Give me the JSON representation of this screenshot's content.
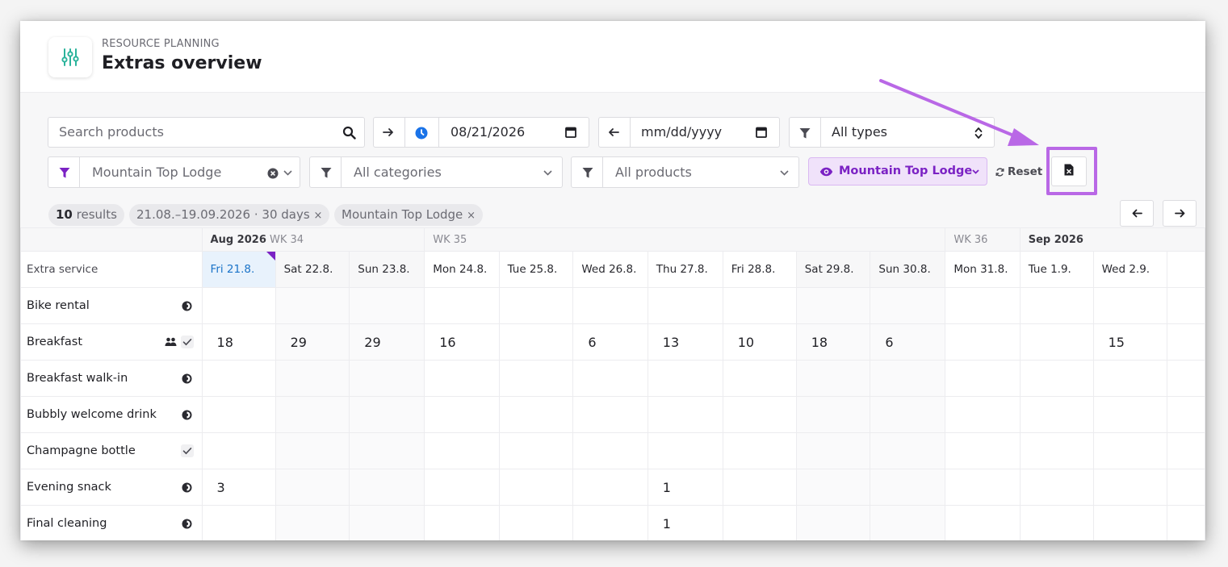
{
  "header": {
    "kicker": "RESOURCE PLANNING",
    "title": "Extras overview",
    "icon": "sliders-icon",
    "accent": "#2bb39b"
  },
  "filters": {
    "search_placeholder": "Search products",
    "from_date": "08/21/2026",
    "to_date_placeholder": "mm/dd/yyyy",
    "type_select": "All types",
    "location_select": "Mountain Top Lodge",
    "category_select": "All categories",
    "product_select": "All products",
    "view_button": "Mountain Top Lodge",
    "reset_label": "Reset"
  },
  "summary": {
    "results_count": "10",
    "results_label": "results",
    "date_chip": "21.08.–19.09.2026 · 30 days",
    "location_chip": "Mountain Top Lodge",
    "chip_remove": "×"
  },
  "calendar": {
    "week_labels": {
      "c1_month": "Aug 2026",
      "c1_week": "WK 34",
      "c4_week": "WK 35",
      "c11_week": "WK 36",
      "c12_month": "Sep 2026"
    },
    "corner_label": "Extra service",
    "days": [
      "Fri 21.8.",
      "Sat 22.8.",
      "Sun 23.8.",
      "Mon 24.8.",
      "Tue 25.8.",
      "Wed 26.8.",
      "Thu 27.8.",
      "Fri 28.8.",
      "Sat 29.8.",
      "Sun 30.8.",
      "Mon 31.8.",
      "Tue 1.9.",
      "Wed 2.9."
    ],
    "rows": [
      {
        "name": "Bike rental",
        "icons": [
          "clock-half-icon"
        ],
        "values": [
          "",
          "",
          "",
          "",
          "",
          "",
          "",
          "",
          "",
          "",
          "",
          "",
          ""
        ]
      },
      {
        "name": "Breakfast",
        "icons": [
          "guests-icon",
          "check-icon"
        ],
        "values": [
          "18",
          "29",
          "29",
          "16",
          "",
          "6",
          "13",
          "10",
          "18",
          "6",
          "",
          "",
          "15"
        ]
      },
      {
        "name": "Breakfast walk-in",
        "icons": [
          "clock-half-icon"
        ],
        "values": [
          "",
          "",
          "",
          "",
          "",
          "",
          "",
          "",
          "",
          "",
          "",
          "",
          ""
        ]
      },
      {
        "name": "Bubbly welcome drink",
        "icons": [
          "clock-half-icon"
        ],
        "values": [
          "",
          "",
          "",
          "",
          "",
          "",
          "",
          "",
          "",
          "",
          "",
          "",
          ""
        ]
      },
      {
        "name": "Champagne bottle",
        "icons": [
          "check-icon"
        ],
        "values": [
          "",
          "",
          "",
          "",
          "",
          "",
          "",
          "",
          "",
          "",
          "",
          "",
          ""
        ]
      },
      {
        "name": "Evening snack",
        "icons": [
          "clock-half-icon"
        ],
        "values": [
          "3",
          "",
          "",
          "",
          "",
          "",
          "1",
          "",
          "",
          "",
          "",
          "",
          ""
        ]
      },
      {
        "name": "Final cleaning",
        "icons": [
          "clock-half-icon"
        ],
        "values": [
          "",
          "",
          "",
          "",
          "",
          "",
          "1",
          "",
          "",
          "",
          "",
          "",
          ""
        ]
      }
    ]
  },
  "colors": {
    "today_bg": "#e8f2fc",
    "today_text": "#1a73c8",
    "brand_purple": "#7b22c4",
    "annotation": "#b968e6"
  }
}
